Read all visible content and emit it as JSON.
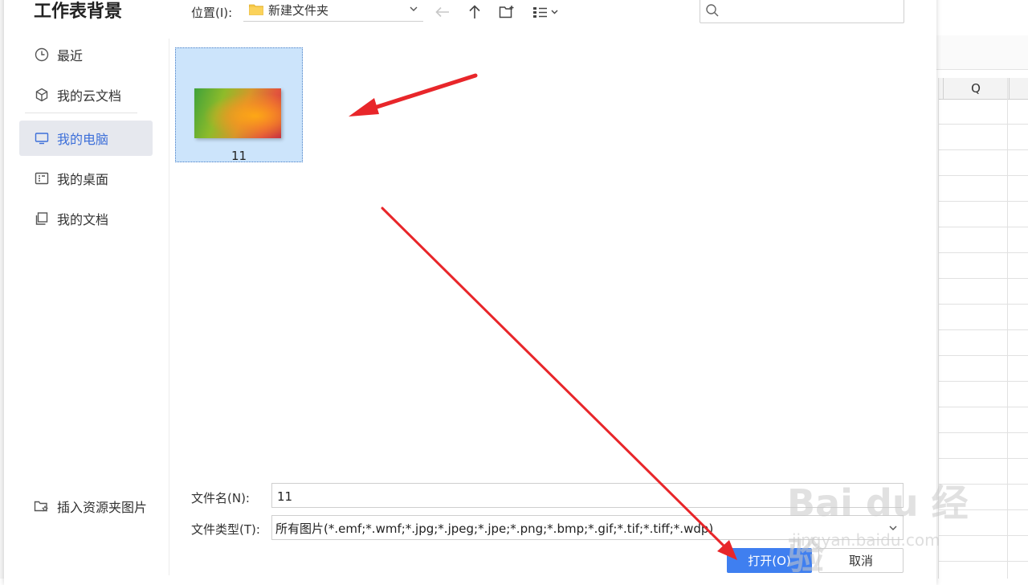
{
  "dialog": {
    "title": "工作表背景"
  },
  "sidebar": {
    "items": [
      {
        "label": "最近",
        "icon": "clock-icon"
      },
      {
        "label": "我的云文档",
        "icon": "cube-icon"
      },
      {
        "label": "我的电脑",
        "icon": "monitor-icon",
        "active": true
      },
      {
        "label": "我的桌面",
        "icon": "desktop-icon"
      },
      {
        "label": "我的文档",
        "icon": "documents-icon"
      }
    ],
    "insert_folder_label": "插入资源夹图片"
  },
  "toolbar": {
    "location_label": "位置(I):",
    "location_value": "新建文件夹",
    "search_placeholder": ""
  },
  "files": [
    {
      "name": "11",
      "selected": true
    }
  ],
  "form": {
    "filename_label": "文件名(N):",
    "filename_value": "11",
    "filetype_label": "文件类型(T):",
    "filetype_value": "所有图片(*.emf;*.wmf;*.jpg;*.jpeg;*.jpe;*.png;*.bmp;*.gif;*.tif;*.tiff;*.wdp)"
  },
  "buttons": {
    "open_label": "打开(O)",
    "cancel_label": "取消"
  },
  "spreadsheet": {
    "column_header": "Q"
  },
  "watermark": {
    "line1": "Bai du 经验",
    "line2": "jingyan.baidu.com"
  },
  "colors": {
    "accent": "#3f7ff0",
    "active_text": "#3d6fd9",
    "selection": "#cce4fb",
    "arrow": "#e8262a"
  }
}
